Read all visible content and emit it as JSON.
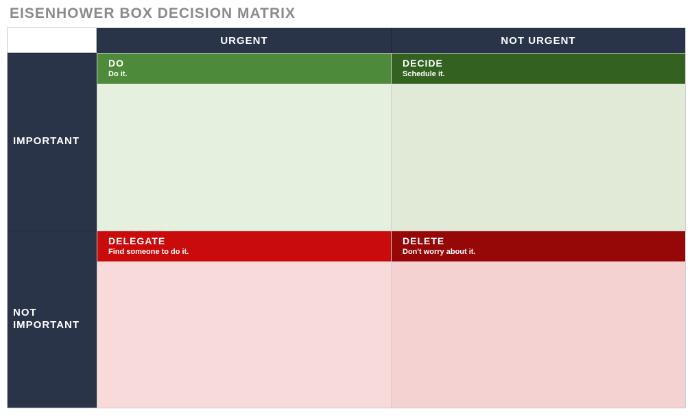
{
  "title": "EISENHOWER BOX DECISION MATRIX",
  "columns": {
    "urgent": "URGENT",
    "not_urgent": "NOT URGENT"
  },
  "rows": {
    "important": "IMPORTANT",
    "not_important": "NOT IMPORTANT"
  },
  "quadrants": {
    "do": {
      "label": "DO",
      "hint": "Do it."
    },
    "decide": {
      "label": "DECIDE",
      "hint": "Schedule it."
    },
    "delegate": {
      "label": "DELEGATE",
      "hint": "Find someone to do it."
    },
    "delete": {
      "label": "DELETE",
      "hint": "Don't worry about it."
    }
  },
  "colors": {
    "header_bg": "#2a3449",
    "do_head": "#4d8a3a",
    "do_body": "#e6f0df",
    "decide_head": "#33611f",
    "decide_body": "#e0ead7",
    "delegate_head": "#c90b0b",
    "delegate_body": "#f8dada",
    "delete_head": "#960707",
    "delete_body": "#f5d2d2"
  }
}
